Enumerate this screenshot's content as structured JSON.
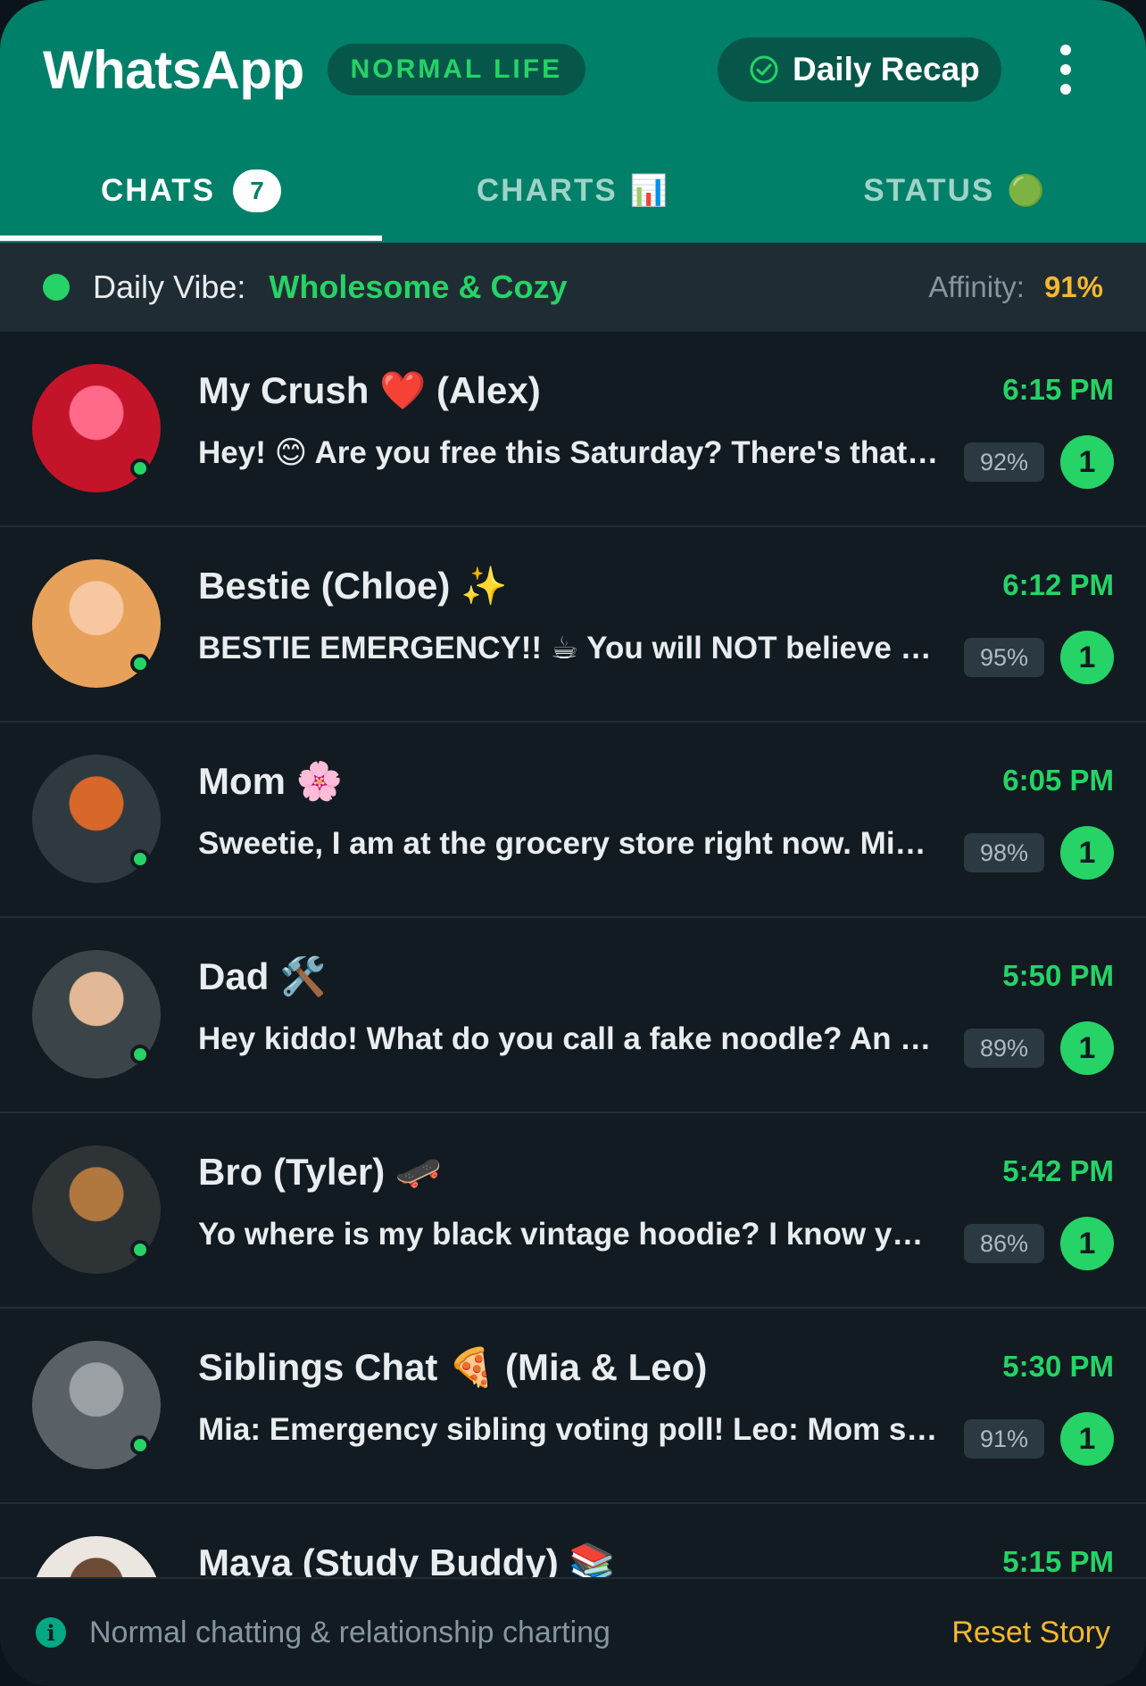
{
  "header": {
    "brand": "WhatsApp",
    "mode_badge": "NORMAL LIFE",
    "recap_label": "Daily Recap"
  },
  "tabs": [
    {
      "label": "CHATS",
      "badge": "7",
      "active": true
    },
    {
      "label": "CHARTS",
      "glyph": "📊",
      "active": false
    },
    {
      "label": "STATUS",
      "glyph": "🟢",
      "active": false
    }
  ],
  "vibe": {
    "label": "Daily Vibe:",
    "value": "Wholesome & Cozy",
    "affinity_label": "Affinity:",
    "affinity_value": "91%"
  },
  "chats": [
    {
      "name": "My Crush ❤️ (Alex)",
      "time": "6:15 PM",
      "preview": "Hey! 😊 Are you free this Saturday? There's that new café downtown",
      "affinity": "92%",
      "unread": "1",
      "avatar_icon": "crush-avatar",
      "avatar_colors": [
        "#c4142a",
        "#ff6a8a"
      ]
    },
    {
      "name": "Bestie (Chloe) ✨",
      "time": "6:12 PM",
      "preview": "BESTIE EMERGENCY!! ☕ You will NOT believe what just happened",
      "affinity": "95%",
      "unread": "1",
      "avatar_icon": "bestie-avatar",
      "avatar_colors": [
        "#e8a15a",
        "#f6c7a0"
      ]
    },
    {
      "name": "Mom 🌸",
      "time": "6:05 PM",
      "preview": "Sweetie, I am at the grocery store right now. Missing anything?",
      "affinity": "98%",
      "unread": "1",
      "avatar_icon": "mom-avatar",
      "avatar_colors": [
        "#2f3a40",
        "#d8672a"
      ]
    },
    {
      "name": "Dad 🛠️",
      "time": "5:50 PM",
      "preview": "Hey kiddo! What do you call a fake noodle? An impasta!",
      "affinity": "89%",
      "unread": "1",
      "avatar_icon": "dad-avatar",
      "avatar_colors": [
        "#3b4448",
        "#e2b896"
      ]
    },
    {
      "name": "Bro (Tyler) 🛹",
      "time": "5:42 PM",
      "preview": "Yo where is my black vintage hoodie? I know you took it",
      "affinity": "86%",
      "unread": "1",
      "avatar_icon": "bro-avatar",
      "avatar_colors": [
        "#2e3336",
        "#b0773f"
      ]
    },
    {
      "name": "Siblings Chat 🍕 (Mia & Leo)",
      "time": "5:30 PM",
      "preview": "Mia: Emergency sibling voting poll! Leo: Mom said pizza tonight",
      "affinity": "91%",
      "unread": "1",
      "avatar_icon": "siblings-avatar",
      "avatar_colors": [
        "#5a6166",
        "#9aa0a4"
      ]
    },
    {
      "name": "Maya (Study Buddy) 📚",
      "time": "5:15 PM",
      "preview": "",
      "affinity": "",
      "unread": "",
      "avatar_icon": "study-buddy-avatar",
      "avatar_colors": [
        "#ece6e0",
        "#6b4a36"
      ]
    }
  ],
  "footer": {
    "info_text": "Normal chatting & relationship charting",
    "reset_label": "Reset Story"
  },
  "colors": {
    "header": "#008069",
    "accent": "#25d366",
    "background": "#111b21",
    "highlight": "#f5b82e"
  }
}
